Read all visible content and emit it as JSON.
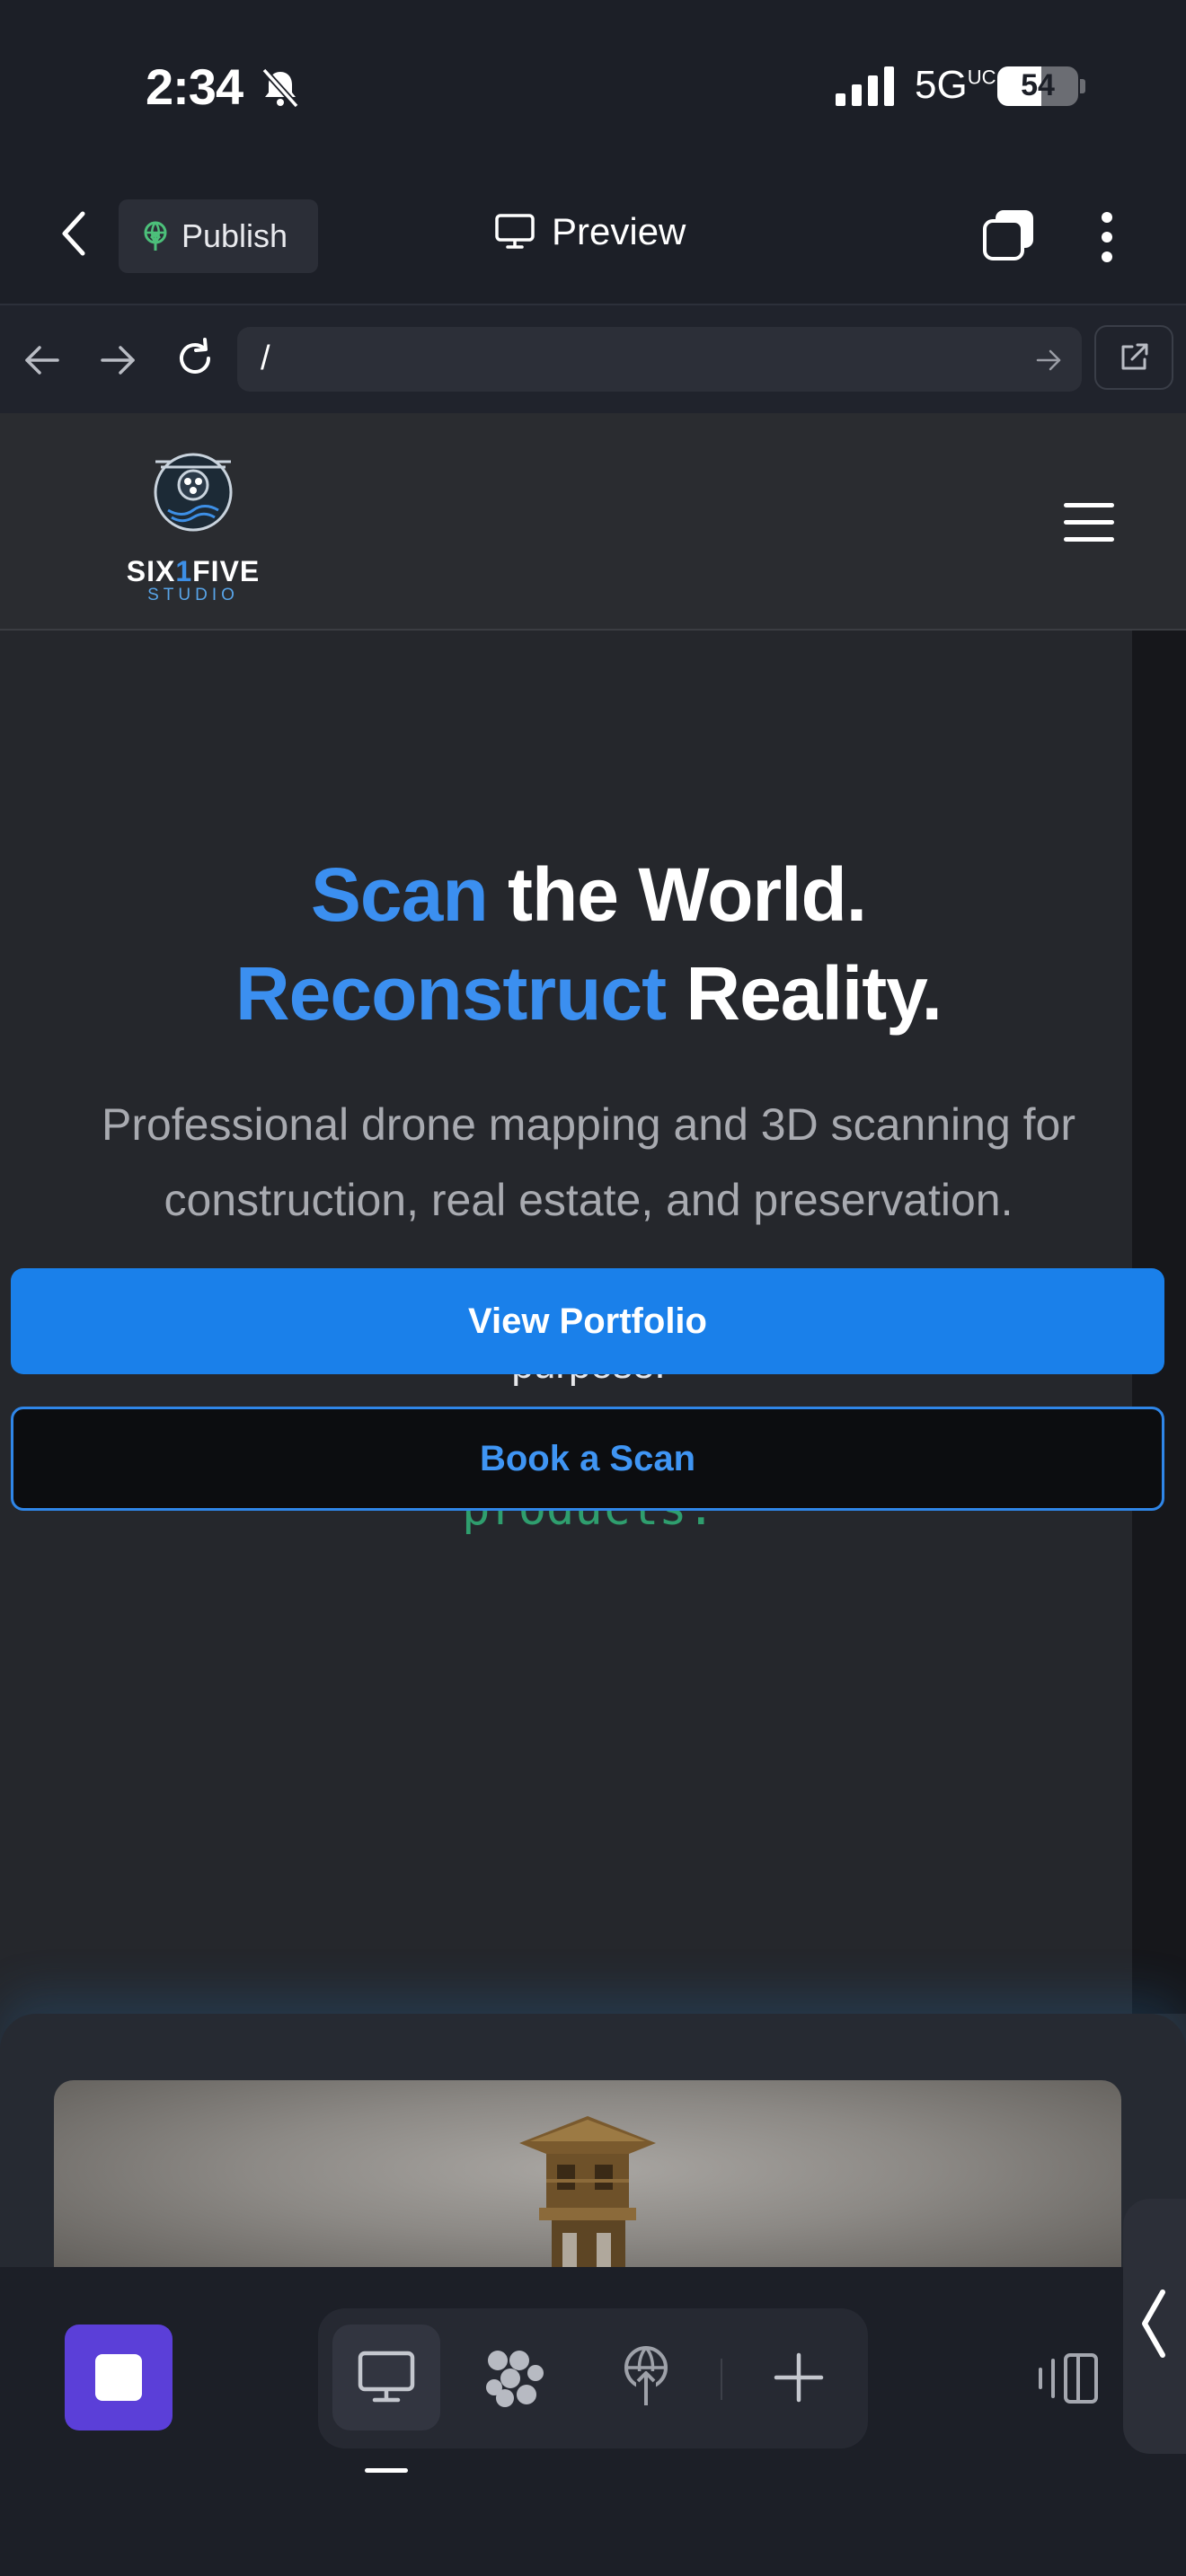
{
  "status": {
    "time": "2:34",
    "network": "5G",
    "network_suffix": "UC",
    "battery": "54",
    "battery_level": 0.54
  },
  "editor": {
    "publish_label": "Publish",
    "preview_label": "Preview"
  },
  "browser": {
    "url": "/"
  },
  "site": {
    "logo": {
      "name_a": "SIX",
      "name_b": "1",
      "name_c": "FIVE",
      "studio": "STUDIO"
    },
    "hero": {
      "line1_accent": "Scan",
      "line1_rest": " the World.",
      "line2_accent": "Reconstruct",
      "line2_rest": " Reality.",
      "lead": "Professional drone mapping and 3D scanning for construction, real estate, and preservation.",
      "sub": "Drone mapping, LiDAR, photogrammetry — all captured with purpose.",
      "mono": "I turn real spaces into digital products."
    },
    "buttons": {
      "portfolio": "View Portfolio",
      "book": "Book a Scan"
    }
  },
  "colors": {
    "accent": "#1a80ea",
    "mono_text": "#2f9e6e",
    "app_icon": "#5b3fd8"
  },
  "toolbar": {
    "icons": [
      "desktop-icon",
      "components-icon",
      "publish-icon",
      "add-icon"
    ]
  }
}
